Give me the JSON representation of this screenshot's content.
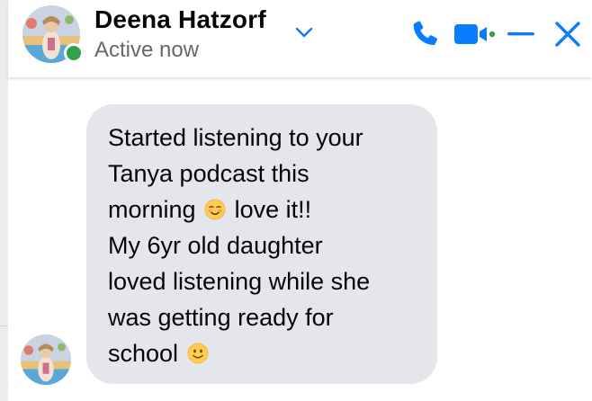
{
  "header": {
    "name": "Deena Hatzorf",
    "status": "Active now",
    "icons": {
      "call": "phone-icon",
      "video": "video-camera-icon",
      "minimize": "minimize-icon",
      "close": "close-icon",
      "dropdown": "chevron-down-icon"
    }
  },
  "message": {
    "lines": [
      "Started listening to your",
      "Tanya podcast this",
      "morning",
      "love it!!",
      "My 6yr old daughter",
      "loved listening  while she",
      "was getting ready for",
      "school"
    ],
    "emojis": [
      "smiling-face-blushing-emoji",
      "slightly-smiling-face-emoji"
    ]
  },
  "colors": {
    "accent": "#0a7cff",
    "bubble": "#e4e6eb",
    "presence": "#31a24c",
    "text": "#050505",
    "secondary_text": "#65676b"
  }
}
